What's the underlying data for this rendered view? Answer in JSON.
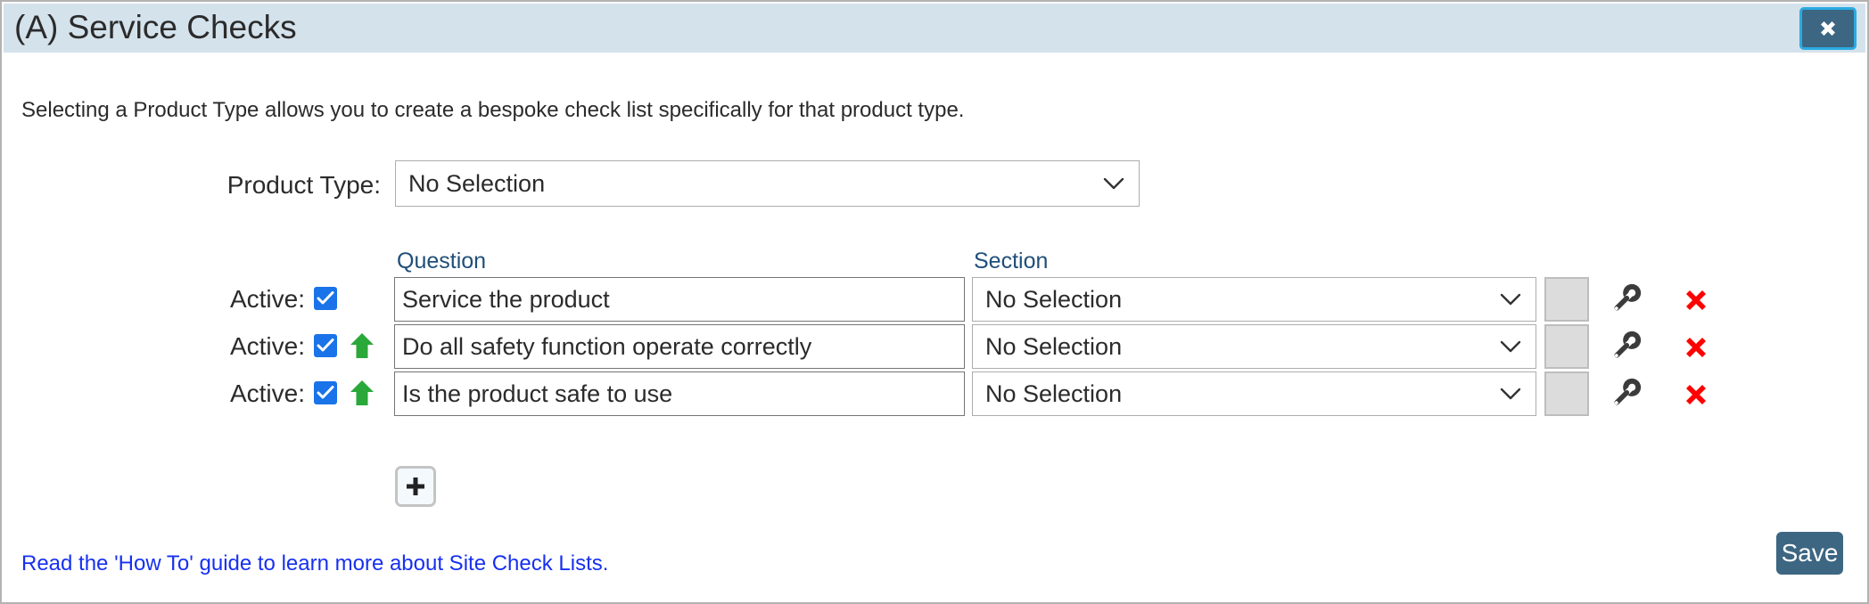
{
  "dialog": {
    "title": "(A) Service Checks",
    "close_label": "close-icon"
  },
  "intro": {
    "text": "Selecting a Product Type allows you to create a bespoke check list specifically for that product type."
  },
  "product_type": {
    "label": "Product Type:",
    "value": "No Selection",
    "options": [
      "No Selection"
    ]
  },
  "columns": {
    "question": "Question",
    "section": "Section"
  },
  "rows": [
    {
      "active_label": "Active:",
      "active_checked": true,
      "has_move_up": false,
      "question": "Service the product",
      "section": "No Selection",
      "blank_button_label": "",
      "settings_icon": "wrench-icon",
      "delete_icon": "red-x-icon"
    },
    {
      "active_label": "Active:",
      "active_checked": true,
      "has_move_up": true,
      "question": "Do all safety function operate correctly",
      "section": "No Selection",
      "blank_button_label": "",
      "settings_icon": "wrench-icon",
      "delete_icon": "red-x-icon"
    },
    {
      "active_label": "Active:",
      "active_checked": true,
      "has_move_up": true,
      "question": "Is the product safe to use",
      "section": "No Selection",
      "blank_button_label": "",
      "settings_icon": "wrench-icon",
      "delete_icon": "red-x-icon"
    }
  ],
  "add_button": {
    "label": "+"
  },
  "footer": {
    "help_link": "Read the 'How To' guide to learn more about Site Check Lists.",
    "save_label": "Save"
  },
  "colors": {
    "header_bar": "#d4e2ec",
    "accent_button": "#3d6682",
    "close_outline": "#2aabe2",
    "column_header_text": "#1f4e79",
    "link": "#1730f0",
    "checkbox": "#1a73e8",
    "move_up_arrow": "#2aa83a",
    "delete_x": "#ff0000"
  }
}
